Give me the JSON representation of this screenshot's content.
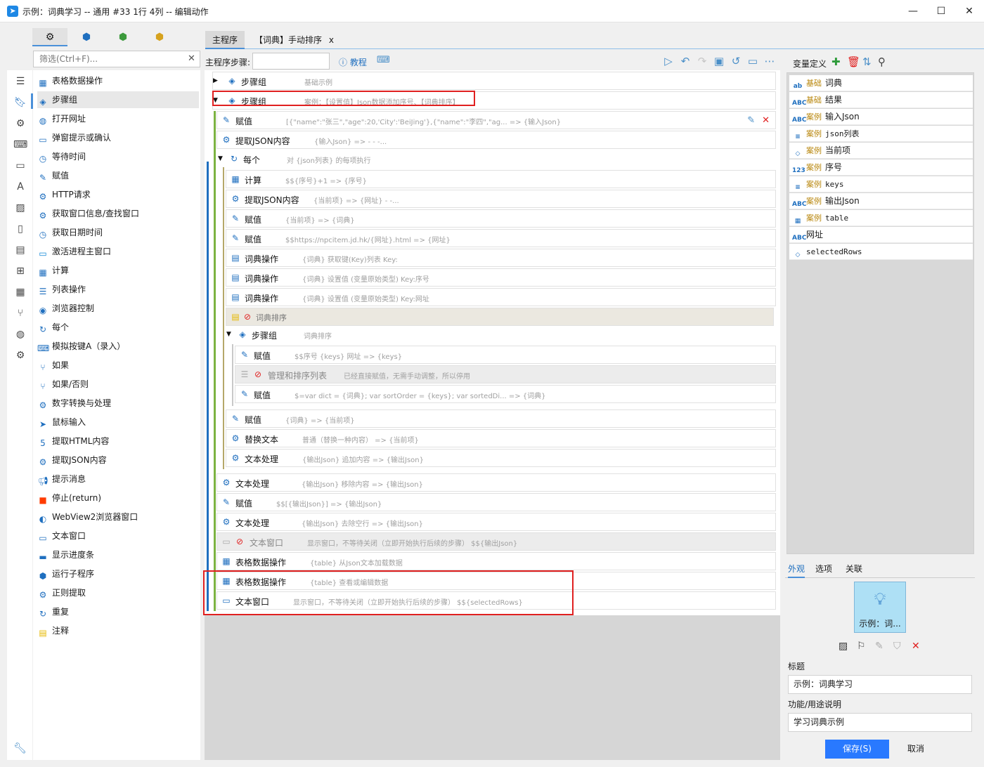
{
  "window": {
    "title": "示例：词典学习 -- 通用 #33 1行 4列 -- 编辑动作",
    "minimize": "—",
    "maximize": "☐",
    "close": "✕"
  },
  "filter": {
    "placeholder": "筛选(Ctrl+F)...",
    "clear": "✕"
  },
  "activities": [
    {
      "label": "表格数据操作",
      "icon": "table-icon"
    },
    {
      "label": "步骤组",
      "icon": "layers-icon",
      "selected": true
    },
    {
      "label": "打开网址",
      "icon": "globe-icon"
    },
    {
      "label": "弹窗提示或确认",
      "icon": "dialog-icon"
    },
    {
      "label": "等待时间",
      "icon": "clock-icon"
    },
    {
      "label": "赋值",
      "icon": "edit-icon"
    },
    {
      "label": "HTTP请求",
      "icon": "gear-icon"
    },
    {
      "label": "获取窗口信息/查找窗口",
      "icon": "gear-icon"
    },
    {
      "label": "获取日期时间",
      "icon": "clock-icon"
    },
    {
      "label": "激活进程主窗口",
      "icon": "window-icon"
    },
    {
      "label": "计算",
      "icon": "calculator-icon"
    },
    {
      "label": "列表操作",
      "icon": "list-icon"
    },
    {
      "label": "浏览器控制",
      "icon": "chrome-icon"
    },
    {
      "label": "每个",
      "icon": "loop-icon"
    },
    {
      "label": "模拟按键A（录入）",
      "icon": "keyboard-icon"
    },
    {
      "label": "如果",
      "icon": "branch-icon"
    },
    {
      "label": "如果/否则",
      "icon": "branch-icon"
    },
    {
      "label": "数字转换与处理",
      "icon": "gear-icon"
    },
    {
      "label": "鼠标输入",
      "icon": "cursor-icon"
    },
    {
      "label": "提取HTML内容",
      "icon": "html5-icon"
    },
    {
      "label": "提取JSON内容",
      "icon": "gear-icon"
    },
    {
      "label": "提示消息",
      "icon": "megaphone-icon"
    },
    {
      "label": "停止(return)",
      "icon": "stop-icon"
    },
    {
      "label": "WebView2浏览器窗口",
      "icon": "edge-icon"
    },
    {
      "label": "文本窗口",
      "icon": "window-icon"
    },
    {
      "label": "显示进度条",
      "icon": "progress-icon"
    },
    {
      "label": "运行子程序",
      "icon": "subprogram-icon"
    },
    {
      "label": "正则提取",
      "icon": "gear-icon"
    },
    {
      "label": "重复",
      "icon": "repeat-icon"
    },
    {
      "label": "注释",
      "icon": "note-icon"
    }
  ],
  "tabs": {
    "main": "主程序",
    "dict": "【词典】手动排序",
    "dict_close": "x"
  },
  "toolbar": {
    "steps_label": "主程序步骤:",
    "tutorial": "教程"
  },
  "steps": [
    {
      "name": "步骤组",
      "desc": "基础示例",
      "icon": "layers-icon"
    },
    {
      "name": "步骤组",
      "desc": "案例：【设置值】Json数据添加序号、【词典排序】",
      "icon": "layers-icon"
    },
    {
      "name": "赋值",
      "desc": "[{\"name\":\"张三\",\"age\":20,'City':'BeiJing'},{\"name\":\"李四\",\"ag... => {输入Json}",
      "icon": "edit-icon"
    },
    {
      "name": "提取JSON内容",
      "desc": "{输入Json} => - - -...",
      "icon": "gear-icon"
    },
    {
      "name": "每个",
      "desc": "对 {json列表} 的每项执行",
      "icon": "loop-icon"
    },
    {
      "name": "计算",
      "desc": "$${序号}+1 => {序号}",
      "icon": "calculator-icon"
    },
    {
      "name": "提取JSON内容",
      "desc": "{当前项} => {网址} - -...",
      "icon": "gear-icon"
    },
    {
      "name": "赋值",
      "desc": "{当前项} => {词典}",
      "icon": "edit-icon"
    },
    {
      "name": "赋值",
      "desc": "$$https://npcitem.jd.hk/{网址}.html => {网址}",
      "icon": "edit-icon"
    },
    {
      "name": "词典操作",
      "desc": "{词典} 获取键(Key)列表 Key:",
      "icon": "dict-icon"
    },
    {
      "name": "词典操作",
      "desc": "{词典} 设置值 (变量原始类型) Key:序号",
      "icon": "dict-icon"
    },
    {
      "name": "词典操作",
      "desc": "{词典} 设置值 (变量原始类型) Key:网址",
      "icon": "dict-icon"
    },
    {
      "name": "词典排序",
      "desc": "",
      "icon": "note-icon"
    },
    {
      "name": "步骤组",
      "desc": "词典排序",
      "icon": "layers-icon"
    },
    {
      "name": "赋值",
      "desc": "$$序号  {keys}  网址 => {keys}",
      "icon": "edit-icon"
    },
    {
      "name": "管理和排序列表",
      "desc": "已经直接赋值，无需手动调整，所以停用",
      "icon": "list-icon"
    },
    {
      "name": "赋值",
      "desc": "$=var dict = {词典};  var sortOrder = {keys};  var sortedDi... => {词典}",
      "icon": "edit-icon"
    },
    {
      "name": "赋值",
      "desc": "{词典} => {当前项}",
      "icon": "edit-icon"
    },
    {
      "name": "替换文本",
      "desc": "普通（替换一种内容）  => {当前项}",
      "icon": "gear-icon"
    },
    {
      "name": "文本处理",
      "desc": "{输出Json} 追加内容 => {输出Json}",
      "icon": "gear-icon"
    },
    {
      "name": "文本处理",
      "desc": "{输出Json} 移除内容 => {输出Json}",
      "icon": "gear-icon"
    },
    {
      "name": "赋值",
      "desc": "$$[{输出Json}] => {输出Json}",
      "icon": "edit-icon"
    },
    {
      "name": "文本处理",
      "desc": "{输出Json} 去除空行 => {输出Json}",
      "icon": "gear-icon"
    },
    {
      "name": "文本窗口",
      "desc": "显示窗口，不等待关闭（立即开始执行后续的步骤） $${输出Json}",
      "icon": "window-icon"
    },
    {
      "name": "表格数据操作",
      "desc": "{table} 从Json文本加载数据",
      "icon": "table-icon"
    },
    {
      "name": "表格数据操作",
      "desc": "{table} 查看或编辑数据",
      "icon": "table-icon"
    },
    {
      "name": "文本窗口",
      "desc": "显示窗口，不等待关闭（立即开始执行后续的步骤）  $${selectedRows}",
      "icon": "window-icon"
    }
  ],
  "variables_panel": {
    "title": "变量定义",
    "items": [
      {
        "type": "ab",
        "tag": "基础",
        "name": "词典"
      },
      {
        "type": "ABC",
        "tag": "基础",
        "name": "结果"
      },
      {
        "type": "ABC",
        "tag": "案例",
        "name": "输入Json"
      },
      {
        "type": "≡",
        "tag": "案例",
        "name": "json列表"
      },
      {
        "type": "◇",
        "tag": "案例",
        "name": "当前项"
      },
      {
        "type": "123",
        "tag": "案例",
        "name": "序号"
      },
      {
        "type": "≡",
        "tag": "案例",
        "name": "keys"
      },
      {
        "type": "ABC",
        "tag": "案例",
        "name": "输出Json"
      },
      {
        "type": "▦",
        "tag": "案例",
        "name": "table"
      },
      {
        "type": "ABC",
        "tag": "",
        "name": "网址"
      },
      {
        "type": "◇",
        "tag": "",
        "name": "selectedRows"
      }
    ]
  },
  "properties": {
    "tabs": [
      "外观",
      "选项",
      "关联"
    ],
    "preview_label": "示例：词...",
    "title_label": "标题",
    "title_value": "示例：词典学习",
    "desc_label": "功能/用途说明",
    "desc_value": "学习词典示例",
    "save": "保存(S)",
    "cancel": "取消"
  },
  "colors": {
    "accent": "#2979ff",
    "icon_blue": "#1f6fbf",
    "highlight_red": "#e02020",
    "tag_gold": "#b8860b",
    "bar_blue": "#1f6fbf",
    "bar_green": "#7cb342",
    "bar_olive": "#b5a86a"
  }
}
